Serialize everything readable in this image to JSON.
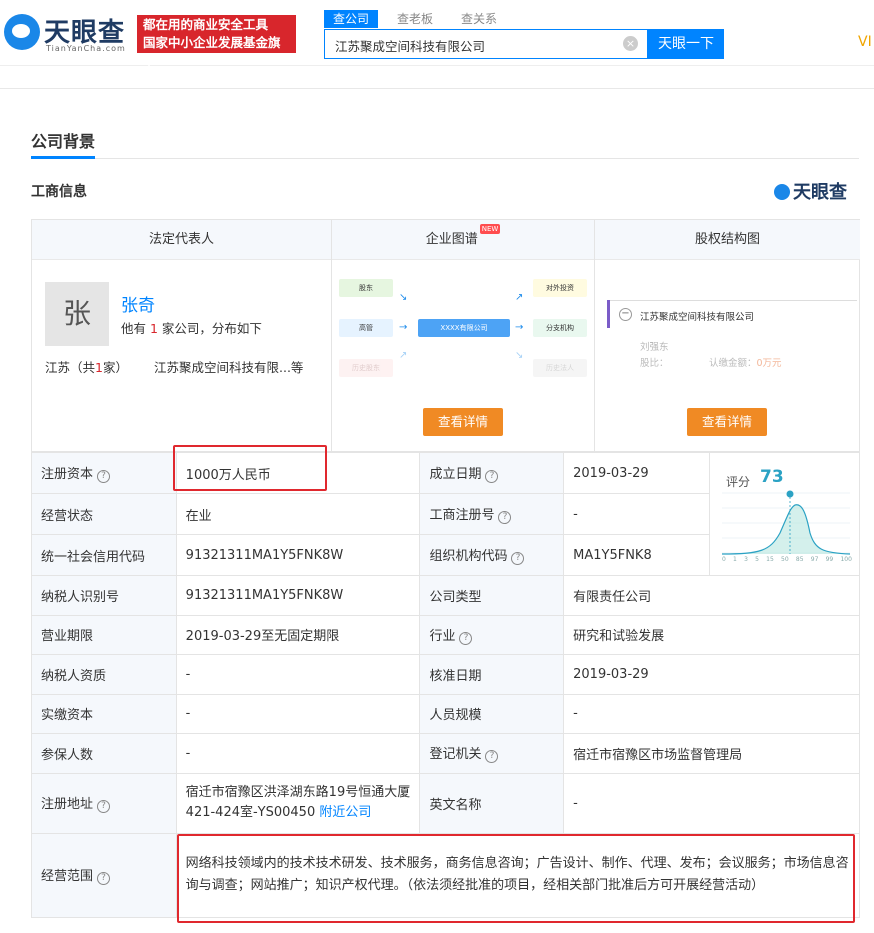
{
  "header": {
    "logo_text": "天眼查",
    "logo_sub": "TianYanCha.com",
    "slogan_line1": "都在用的商业安全工具",
    "slogan_line2": "国家中小企业发展基金旗下",
    "search_tabs": [
      "查公司",
      "查老板",
      "查关系"
    ],
    "search_value": "江苏聚成空间科技有限公司",
    "search_button": "天眼一下",
    "vip": "VI"
  },
  "section": {
    "title": "公司背景",
    "subtitle": "工商信息",
    "brand": "天眼查"
  },
  "cards": {
    "legal_rep": {
      "head": "法定代表人",
      "avatar": "张",
      "name": "张奇",
      "info_pre": "他有 ",
      "info_count": "1",
      "info_post": " 家公司，分布如下",
      "prov_pre": "江苏（共",
      "prov_count": "1",
      "prov_post": "家）",
      "companies": "江苏聚成空间科技有限...等"
    },
    "graph": {
      "head": "企业图谱",
      "new_badge": "NEW",
      "nodes": {
        "shareholder": "股东",
        "exec": "高管",
        "history_sh": "历史股东",
        "center": "XXXX有限公司",
        "invest": "对外投资",
        "branch": "分支机构",
        "history_legal": "历史法人"
      },
      "button": "查看详情"
    },
    "equity": {
      "head": "股权结构图",
      "company": "江苏聚成空间科技有限公司",
      "person": "刘强东",
      "ratio_label": "股比：",
      "amount_label": "认缴金额：",
      "amount": "0万元",
      "button": "查看详情"
    }
  },
  "score": {
    "label": "评分",
    "value": "73",
    "axis": [
      "0",
      "1",
      "3",
      "5",
      "15",
      "50",
      "85",
      "97",
      "99",
      "100"
    ]
  },
  "table": {
    "reg_capital_k": "注册资本",
    "reg_capital_v": "1000万人民币",
    "est_date_k": "成立日期",
    "est_date_v": "2019-03-29",
    "status_k": "经营状态",
    "status_v": "在业",
    "reg_no_k": "工商注册号",
    "reg_no_v": "-",
    "credit_code_k": "统一社会信用代码",
    "credit_code_v": "91321311MA1Y5FNK8W",
    "org_code_k": "组织机构代码",
    "org_code_v": "MA1Y5FNK8",
    "taxpayer_id_k": "纳税人识别号",
    "taxpayer_id_v": "91321311MA1Y5FNK8W",
    "company_type_k": "公司类型",
    "company_type_v": "有限责任公司",
    "term_k": "营业期限",
    "term_v": "2019-03-29至无固定期限",
    "industry_k": "行业",
    "industry_v": "研究和试验发展",
    "taxpayer_q_k": "纳税人资质",
    "taxpayer_q_v": "-",
    "approval_k": "核准日期",
    "approval_v": "2019-03-29",
    "paid_k": "实缴资本",
    "paid_v": "-",
    "staff_k": "人员规模",
    "staff_v": "-",
    "insured_k": "参保人数",
    "insured_v": "-",
    "authority_k": "登记机关",
    "authority_v": "宿迁市宿豫区市场监督管理局",
    "address_k": "注册地址",
    "address_v": "宿迁市宿豫区洪泽湖东路19号恒通大厦421-424室-YS00450",
    "nearby": "附近公司",
    "english_k": "英文名称",
    "english_v": "-",
    "scope_k": "经营范围",
    "scope_v": "网络科技领域内的技术技术研发、技术服务，商务信息咨询；广告设计、制作、代理、发布；会议服务；市场信息咨询与调查；网站推广；知识产权代理。（依法须经批准的项目，经相关部门批准后方可开展经营活动）"
  }
}
